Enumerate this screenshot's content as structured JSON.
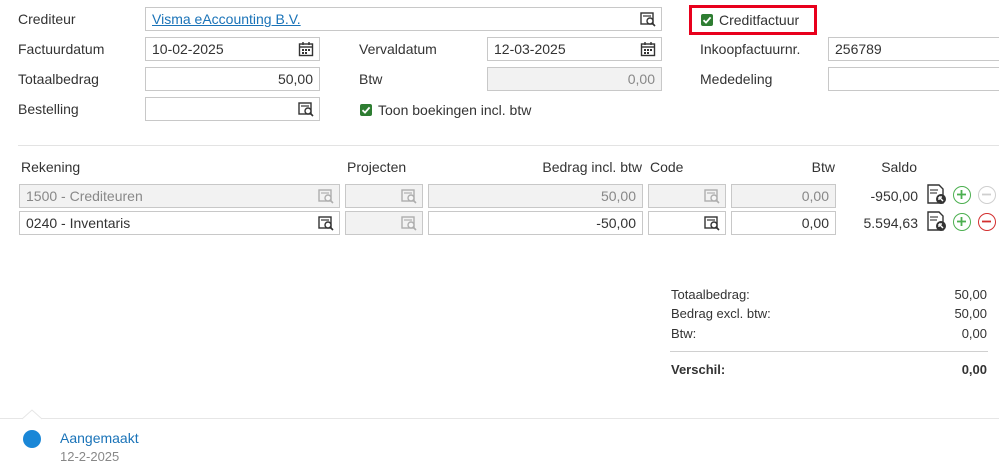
{
  "header": {
    "crediteur_label": "Crediteur",
    "crediteur_value": "Visma eAccounting B.V.",
    "creditfactuur_label": "Creditfactuur",
    "factuurdatum_label": "Factuurdatum",
    "factuurdatum_value": "10-02-2025",
    "vervaldatum_label": "Vervaldatum",
    "vervaldatum_value": "12-03-2025",
    "inkoop_label": "Inkoopfactuurnr.",
    "inkoop_value": "256789",
    "totaalbedrag_label": "Totaalbedrag",
    "totaalbedrag_value": "50,00",
    "btw_label": "Btw",
    "btw_value": "0,00",
    "mededeling_label": "Mededeling",
    "bestelling_label": "Bestelling",
    "toon_label": "Toon boekingen incl. btw"
  },
  "table": {
    "col_rekening": "Rekening",
    "col_projecten": "Projecten",
    "col_bedrag": "Bedrag incl. btw",
    "col_code": "Code",
    "col_btw": "Btw",
    "col_saldo": "Saldo",
    "rows": [
      {
        "rekening": "1500 - Crediteuren",
        "bedrag": "50,00",
        "btw": "0,00",
        "saldo": "-950,00"
      },
      {
        "rekening": "0240 - Inventaris",
        "bedrag": "-50,00",
        "btw": "0,00",
        "saldo": "5.594,63"
      }
    ]
  },
  "summary": {
    "totaal_label": "Totaalbedrag:",
    "totaal_value": "50,00",
    "excl_label": "Bedrag excl. btw:",
    "excl_value": "50,00",
    "btw_label": "Btw:",
    "btw_value": "0,00",
    "verschil_label": "Verschil:",
    "verschil_value": "0,00"
  },
  "timeline": {
    "status": "Aangemaakt",
    "date": "12-2-2025"
  },
  "colors": {
    "accent": "#1a73b8",
    "highlight": "#e8001c",
    "check": "#2e7d32",
    "add": "#4caf50",
    "remove": "#d32f2f"
  }
}
